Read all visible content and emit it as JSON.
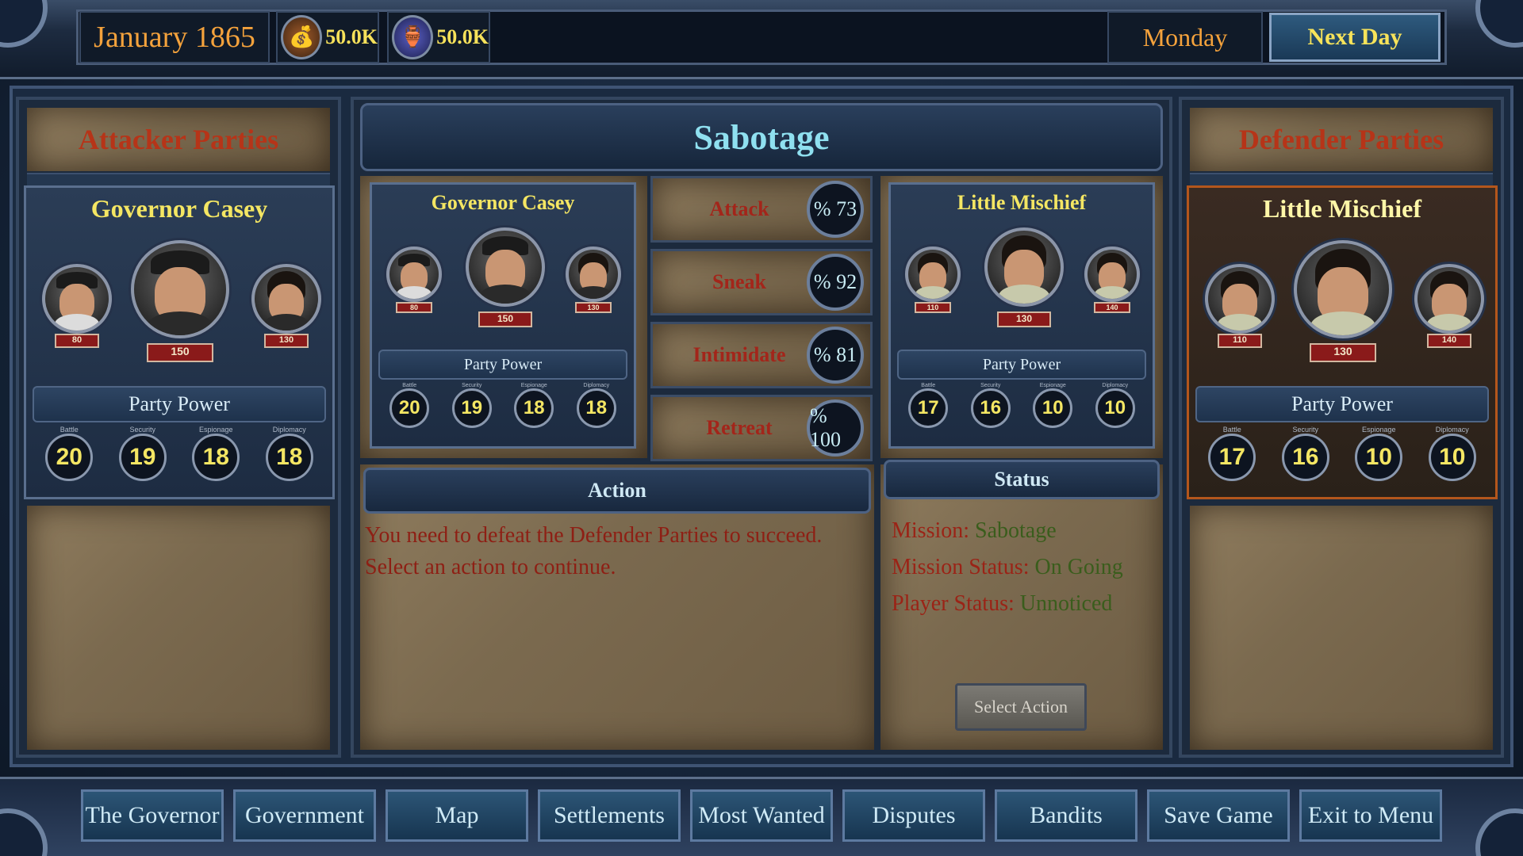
{
  "topbar": {
    "date": "January 1865",
    "money_icon": "money-bag-icon",
    "money": "50.0K",
    "influence_icon": "influence-jar-icon",
    "influence": "50.0K",
    "weekday": "Monday",
    "next_day": "Next Day"
  },
  "mission": {
    "title": "Sabotage"
  },
  "attacker": {
    "header": "Attacker Parties",
    "party": {
      "name": "Governor Casey",
      "members": [
        {
          "level": "80"
        },
        {
          "level": "150"
        },
        {
          "level": "130"
        }
      ],
      "power_label": "Party Power",
      "stats": [
        {
          "label": "Battle",
          "value": "20"
        },
        {
          "label": "Security",
          "value": "19"
        },
        {
          "label": "Espionage",
          "value": "18"
        },
        {
          "label": "Diplomacy",
          "value": "18"
        }
      ]
    }
  },
  "defender": {
    "header": "Defender Parties",
    "party": {
      "name": "Little Mischief",
      "members": [
        {
          "level": "110"
        },
        {
          "level": "130"
        },
        {
          "level": "140"
        }
      ],
      "power_label": "Party Power",
      "stats": [
        {
          "label": "Battle",
          "value": "17"
        },
        {
          "label": "Security",
          "value": "16"
        },
        {
          "label": "Espionage",
          "value": "10"
        },
        {
          "label": "Diplomacy",
          "value": "10"
        }
      ]
    }
  },
  "chances": [
    {
      "label": "Attack",
      "value": "% 73"
    },
    {
      "label": "Sneak",
      "value": "% 92"
    },
    {
      "label": "Intimidate",
      "value": "% 81"
    },
    {
      "label": "Retreat",
      "value": "% 100"
    }
  ],
  "action": {
    "title": "Action",
    "line1": "You need to  defeat the Defender Parties to succeed.",
    "line2": "Select an action to continue."
  },
  "status": {
    "title": "Status",
    "mission_key": "Mission:",
    "mission_val": "Sabotage",
    "mission_status_key": "Mission Status:",
    "mission_status_val": "On Going",
    "player_status_key": "Player Status:",
    "player_status_val": "Unnoticed",
    "select_action": "Select Action"
  },
  "nav": [
    "The Governor",
    "Government",
    "Map",
    "Settlements",
    "Most Wanted",
    "Disputes",
    "Bandits",
    "Save Game",
    "Exit to Menu"
  ]
}
